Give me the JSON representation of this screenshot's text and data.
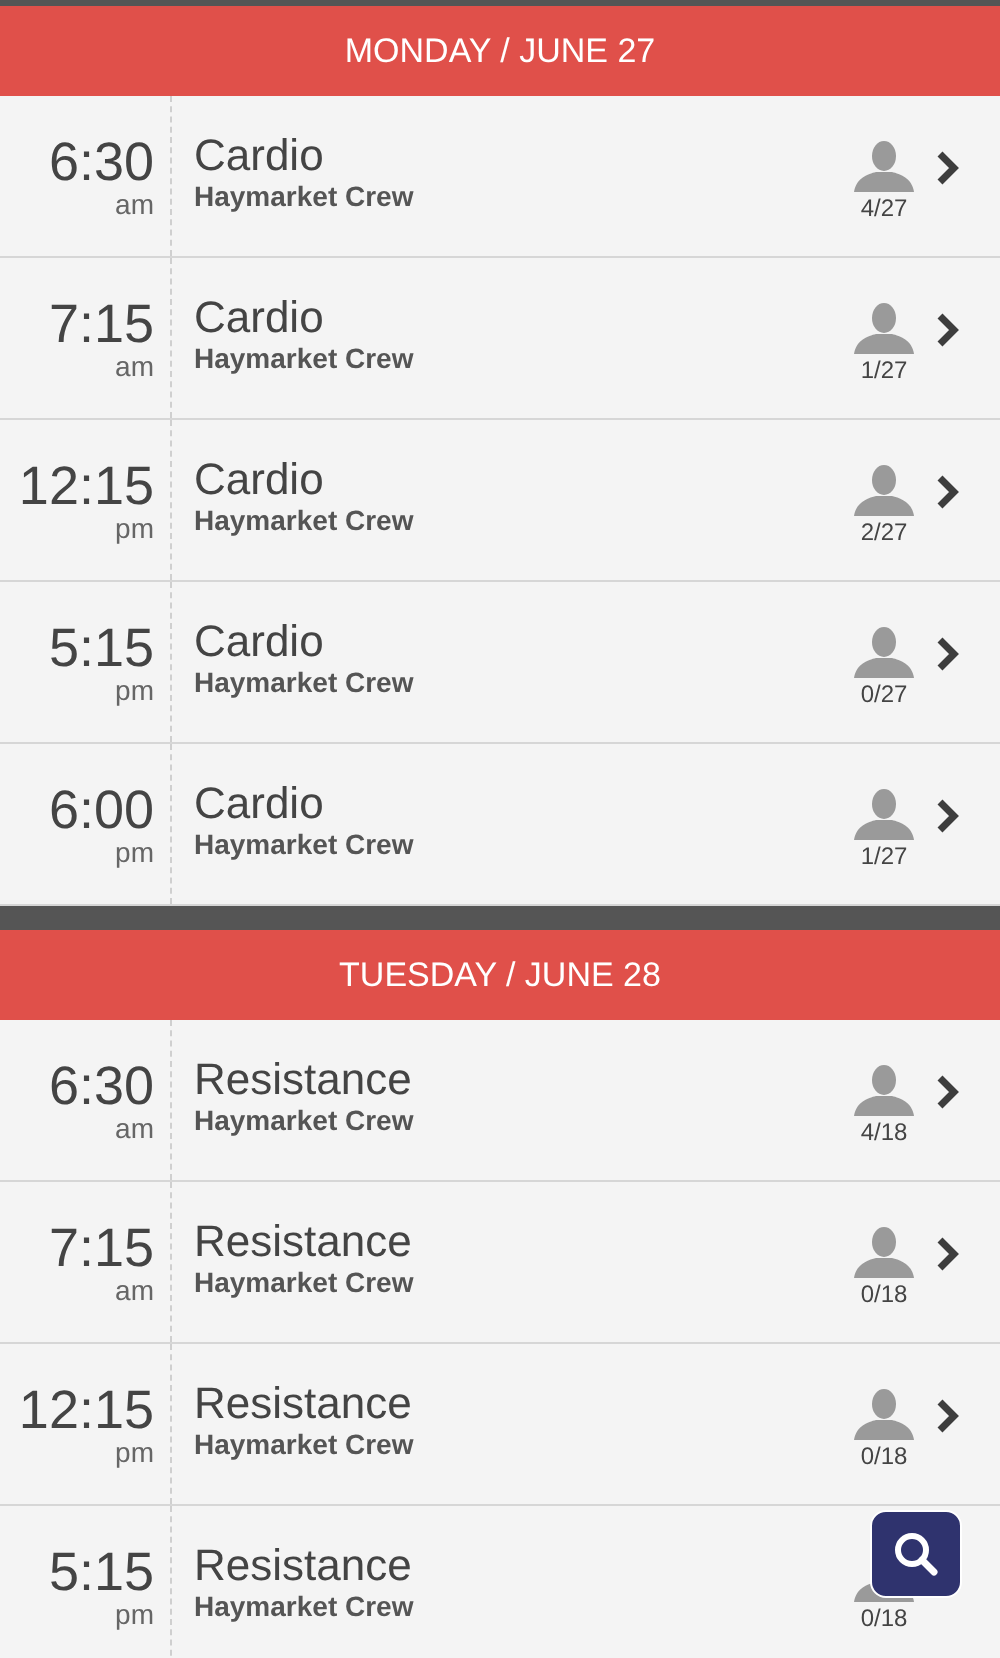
{
  "days": [
    {
      "heading": "MONDAY / JUNE 27",
      "classes": [
        {
          "time": "6:30",
          "period": "am",
          "title": "Cardio",
          "crew": "Haymarket Crew",
          "count": "4/27",
          "chevron": true
        },
        {
          "time": "7:15",
          "period": "am",
          "title": "Cardio",
          "crew": "Haymarket Crew",
          "count": "1/27",
          "chevron": true
        },
        {
          "time": "12:15",
          "period": "pm",
          "title": "Cardio",
          "crew": "Haymarket Crew",
          "count": "2/27",
          "chevron": true
        },
        {
          "time": "5:15",
          "period": "pm",
          "title": "Cardio",
          "crew": "Haymarket Crew",
          "count": "0/27",
          "chevron": true
        },
        {
          "time": "6:00",
          "period": "pm",
          "title": "Cardio",
          "crew": "Haymarket Crew",
          "count": "1/27",
          "chevron": true
        }
      ]
    },
    {
      "heading": "TUESDAY / JUNE 28",
      "classes": [
        {
          "time": "6:30",
          "period": "am",
          "title": "Resistance",
          "crew": "Haymarket Crew",
          "count": "4/18",
          "chevron": true
        },
        {
          "time": "7:15",
          "period": "am",
          "title": "Resistance",
          "crew": "Haymarket Crew",
          "count": "0/18",
          "chevron": true
        },
        {
          "time": "12:15",
          "period": "pm",
          "title": "Resistance",
          "crew": "Haymarket Crew",
          "count": "0/18",
          "chevron": true
        },
        {
          "time": "5:15",
          "period": "pm",
          "title": "Resistance",
          "crew": "Haymarket Crew",
          "count": "0/18",
          "chevron": false
        }
      ]
    }
  ]
}
